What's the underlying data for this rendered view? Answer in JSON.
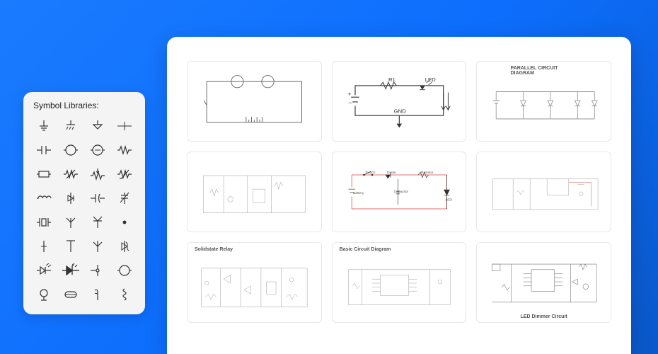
{
  "symbolPanel": {
    "title": "Symbol Libraries:"
  },
  "templates": [
    {
      "title": ""
    },
    {
      "title": "",
      "labels": {
        "r1": "R1",
        "led": "LED",
        "gnd": "GND"
      }
    },
    {
      "title": "PARALLEL  CIRCUIT DIAGRAM"
    },
    {
      "title": ""
    },
    {
      "title": "",
      "labels": {
        "switch": "Switch",
        "diode": "Diode",
        "resistor": "Resistor",
        "battery": "Battery",
        "capacitor": "Capacitor",
        "led": "LED"
      }
    },
    {
      "title": ""
    },
    {
      "title": "Solidstate Relay"
    },
    {
      "title": "Basic Circuit Diagram"
    },
    {
      "title": "LED Dimmer Circuit"
    }
  ]
}
